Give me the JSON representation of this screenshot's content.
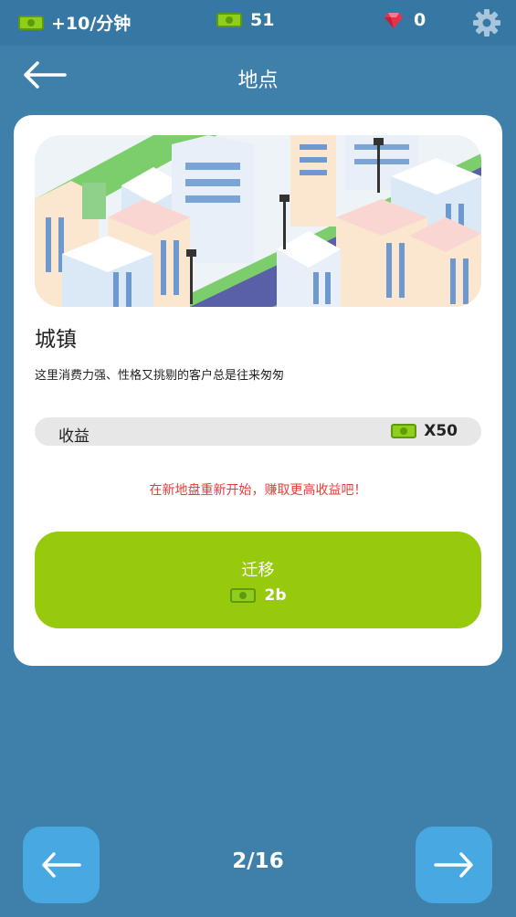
{
  "topbar": {
    "rate": "+10/分钟",
    "cash": "51",
    "gems": "0"
  },
  "header": {
    "title": "地点"
  },
  "location": {
    "name": "城镇",
    "description": "这里消费力强、性格又挑剔的客户总是往来匆匆",
    "income_label": "收益",
    "income_value": "X50",
    "hint": "在新地盘重新开始，赚取更高收益吧！",
    "migrate_label": "迁移",
    "migrate_cost": "2b"
  },
  "pager": {
    "page": "2/16"
  },
  "colors": {
    "background": "#3f80ab",
    "accent_green": "#97c90d",
    "nav_button": "#47a8e2",
    "hint_red": "#e0403a",
    "gem_red": "#e8324c"
  }
}
